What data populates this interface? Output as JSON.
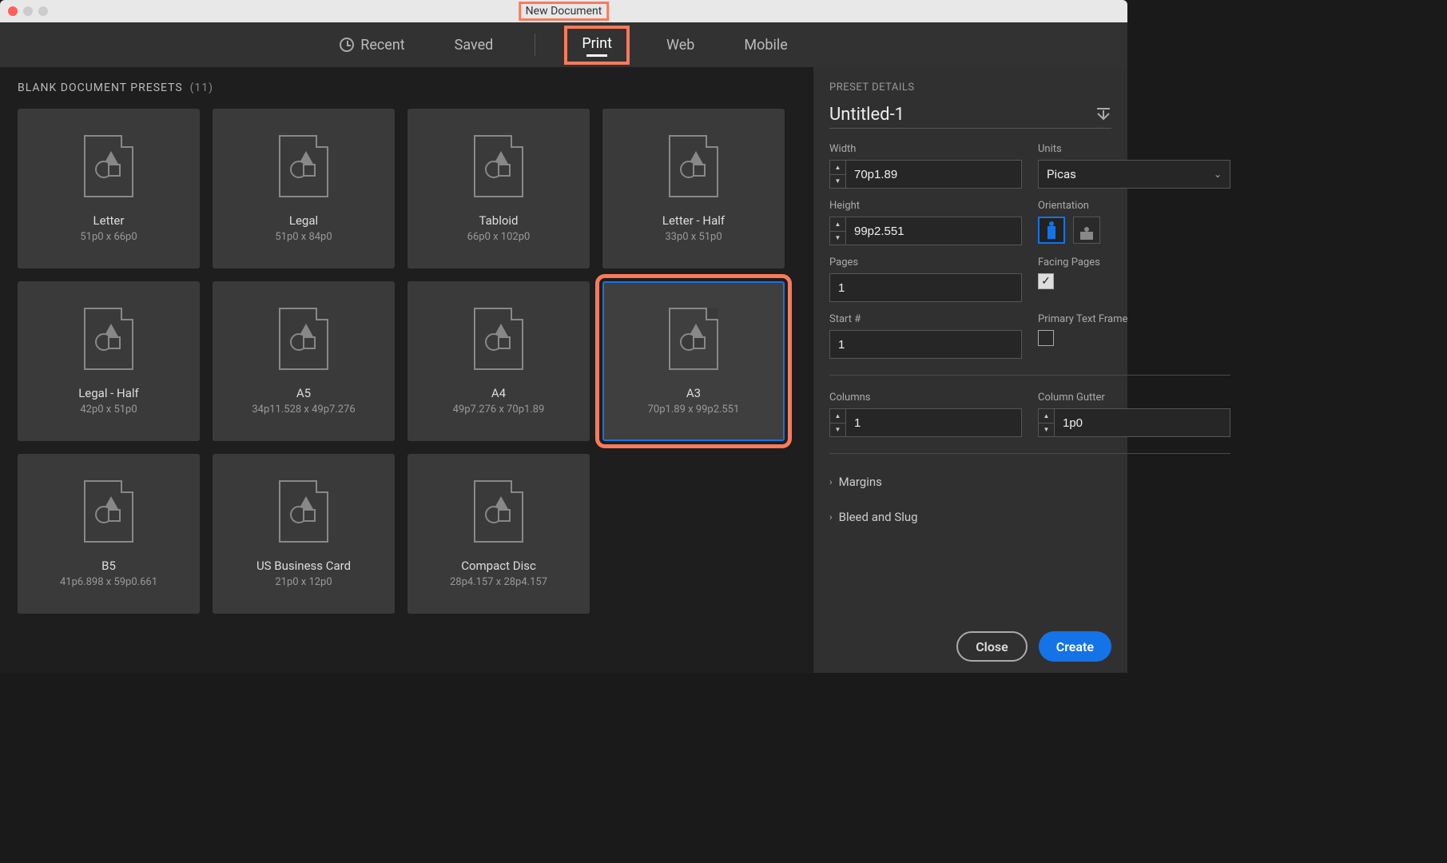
{
  "window": {
    "title": "New Document"
  },
  "tabs": {
    "recent": "Recent",
    "saved": "Saved",
    "print": "Print",
    "web": "Web",
    "mobile": "Mobile",
    "active": "print"
  },
  "left": {
    "heading": "BLANK DOCUMENT PRESETS",
    "count": "(11)"
  },
  "presets": [
    {
      "name": "Letter",
      "dim": "51p0 x 66p0"
    },
    {
      "name": "Legal",
      "dim": "51p0 x 84p0"
    },
    {
      "name": "Tabloid",
      "dim": "66p0 x 102p0"
    },
    {
      "name": "Letter - Half",
      "dim": "33p0 x 51p0"
    },
    {
      "name": "Legal - Half",
      "dim": "42p0 x 51p0"
    },
    {
      "name": "A5",
      "dim": "34p11.528 x 49p7.276"
    },
    {
      "name": "A4",
      "dim": "49p7.276 x 70p1.89"
    },
    {
      "name": "A3",
      "dim": "70p1.89 x 99p2.551",
      "selected": true,
      "highlighted": true
    },
    {
      "name": "B5",
      "dim": "41p6.898 x 59p0.661"
    },
    {
      "name": "US Business Card",
      "dim": "21p0 x 12p0"
    },
    {
      "name": "Compact Disc",
      "dim": "28p4.157 x 28p4.157"
    }
  ],
  "details": {
    "heading": "PRESET DETAILS",
    "docName": "Untitled-1",
    "widthLabel": "Width",
    "widthValue": "70p1.89",
    "unitsLabel": "Units",
    "unitsValue": "Picas",
    "heightLabel": "Height",
    "heightValue": "99p2.551",
    "orientationLabel": "Orientation",
    "pagesLabel": "Pages",
    "pagesValue": "1",
    "facingLabel": "Facing Pages",
    "facingChecked": true,
    "startLabel": "Start #",
    "startValue": "1",
    "primaryTFLabel": "Primary Text Frame",
    "primaryTFChecked": false,
    "columnsLabel": "Columns",
    "columnsValue": "1",
    "gutterLabel": "Column Gutter",
    "gutterValue": "1p0",
    "marginsLabel": "Margins",
    "bleedLabel": "Bleed and Slug",
    "closeBtn": "Close",
    "createBtn": "Create"
  }
}
